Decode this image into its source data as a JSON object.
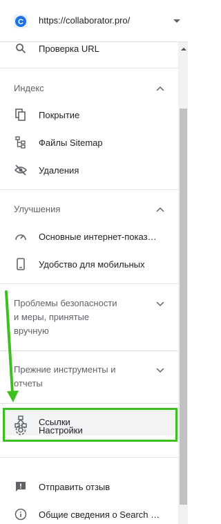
{
  "property": {
    "url": "https://collaborator.pro/",
    "logo_letter": "C",
    "icon": "collaborator-logo-icon"
  },
  "nav": {
    "inspect_url": {
      "label": "Проверка URL",
      "icon": "search-icon"
    },
    "index": {
      "title": "Индекс",
      "items": [
        {
          "label": "Покрытие",
          "icon": "coverage-icon"
        },
        {
          "label": "Файлы Sitemap",
          "icon": "sitemap-icon"
        },
        {
          "label": "Удаления",
          "icon": "removals-icon"
        }
      ]
    },
    "improvements": {
      "title": "Улучшения",
      "items": [
        {
          "label": "Основные интернет-показатели",
          "icon": "speed-gauge-icon"
        },
        {
          "label": "Удобство для мобильных",
          "icon": "mobile-icon"
        }
      ]
    },
    "security": {
      "title_line1": "Проблемы безопасности",
      "title_line2": "и меры, принятые",
      "title_line3": "вручную"
    },
    "legacy": {
      "title_line1": "Прежние инструменты и",
      "title_line2": "отчеты"
    },
    "links": {
      "label": "Ссылки",
      "icon": "links-icon"
    },
    "settings": {
      "label": "Настройки",
      "icon": "gear-icon"
    },
    "feedback": {
      "label": "Отправить отзыв",
      "icon": "feedback-icon"
    },
    "about": {
      "label": "Общие сведения о Search Console",
      "icon": "info-icon"
    }
  },
  "colors": {
    "highlight_border": "#3dbf1f",
    "active_bg": "#f1f3f4",
    "icon_gray": "#5f6368"
  }
}
